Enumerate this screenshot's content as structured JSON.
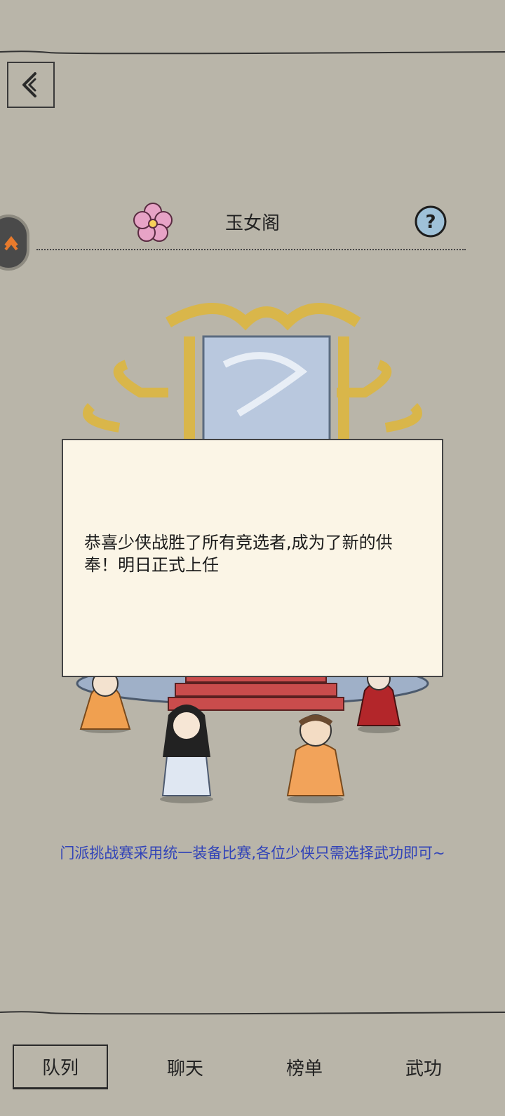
{
  "header": {
    "sect_title": "玉女阁"
  },
  "icons": {
    "back": "back-chevron-icon",
    "flower": "plum-blossom-icon",
    "help": "help-question-icon",
    "side": "side-menu-icon"
  },
  "dialog": {
    "message": "恭喜少侠战胜了所有竞选者,成为了新的供奉！明日正式上任"
  },
  "tip": {
    "text": "门派挑战赛采用统一装备比赛,各位少侠只需选择武功即可~"
  },
  "nav": {
    "items": [
      {
        "label": "队列",
        "active": true
      },
      {
        "label": "聊天",
        "active": false
      },
      {
        "label": "榜单",
        "active": false
      },
      {
        "label": "武功",
        "active": false
      }
    ]
  },
  "colors": {
    "background": "#b9b5a9",
    "dialog_bg": "#fbf5e6",
    "tip_text": "#3143b8"
  }
}
